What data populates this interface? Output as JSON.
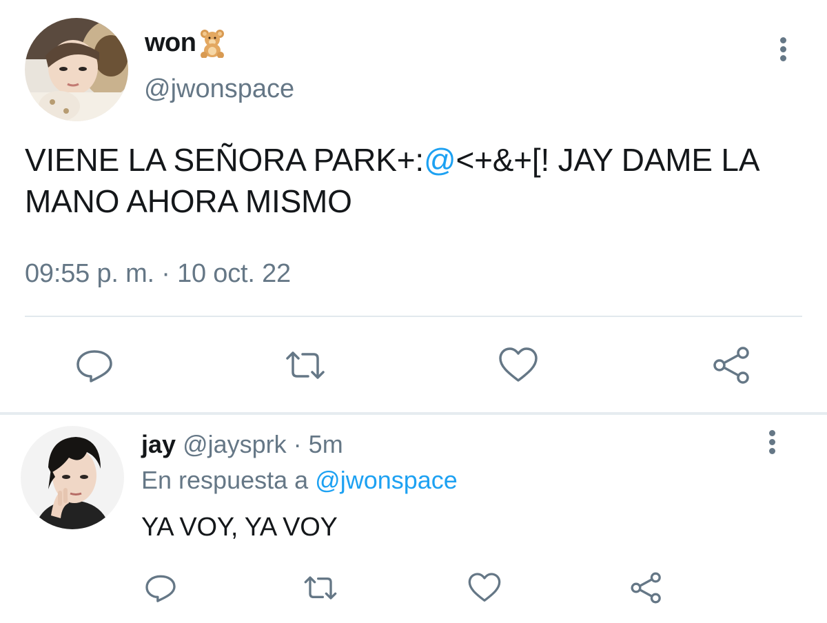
{
  "main_tweet": {
    "author_name": "won",
    "author_emoji": "teddy-bear-icon",
    "handle": "@jwonspace",
    "text_before_mention": "VIENE LA SEÑORA PARK+:",
    "text_mention": "@",
    "text_after_mention": "<+&+[! JAY DAME LA MANO AHORA MISMO",
    "timestamp": "09:55 p. m. · 10 oct. 22"
  },
  "reply": {
    "author_name": "jay",
    "handle": "@jaysprk",
    "time": "5m",
    "separator": "·",
    "replying_to_label": "En respuesta a",
    "replying_to_handle": "@jwonspace",
    "text": "YA VOY, YA VOY"
  },
  "actions": [
    "reply-icon",
    "retweet-icon",
    "like-icon",
    "share-icon"
  ],
  "colors": {
    "text": "#14171a",
    "secondary": "#657786",
    "link": "#1da1f2",
    "divider": "#e1e8ed"
  }
}
